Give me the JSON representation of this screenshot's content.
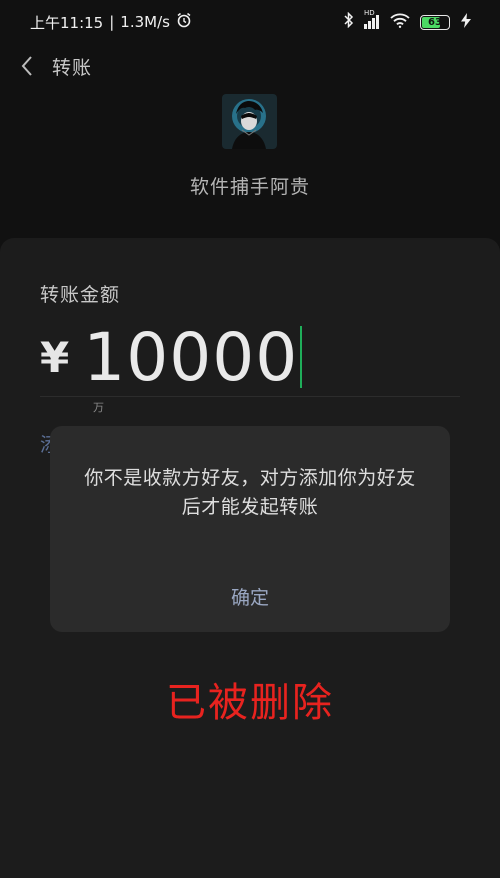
{
  "status_bar": {
    "time": "上午11:15",
    "network_speed": "1.3M/s",
    "signal_label": "HD",
    "battery_level": "63",
    "icons": [
      "alarm-icon",
      "bluetooth-icon",
      "signal-icon",
      "wifi-icon",
      "battery-icon",
      "charging-icon"
    ]
  },
  "topbar": {
    "title": "转账",
    "back_icon": "chevron-left-icon"
  },
  "payee": {
    "name": "软件捕手阿贵"
  },
  "transfer": {
    "amount_label": "转账金额",
    "currency_symbol": "¥",
    "amount": "10000",
    "unit_hint": "万",
    "remark_link_partial": "添"
  },
  "dialog": {
    "message": "你不是收款方好友，对方添加你为好友后才能发起转账",
    "confirm_label": "确定"
  },
  "overlay": {
    "stamp_text": "已被删除"
  },
  "colors": {
    "background": "#111111",
    "card": "#1c1c1c",
    "dialog": "#2b2b2b",
    "cursor": "#1fae5a",
    "link": "#5b6f96",
    "stamp": "#e8231f"
  }
}
